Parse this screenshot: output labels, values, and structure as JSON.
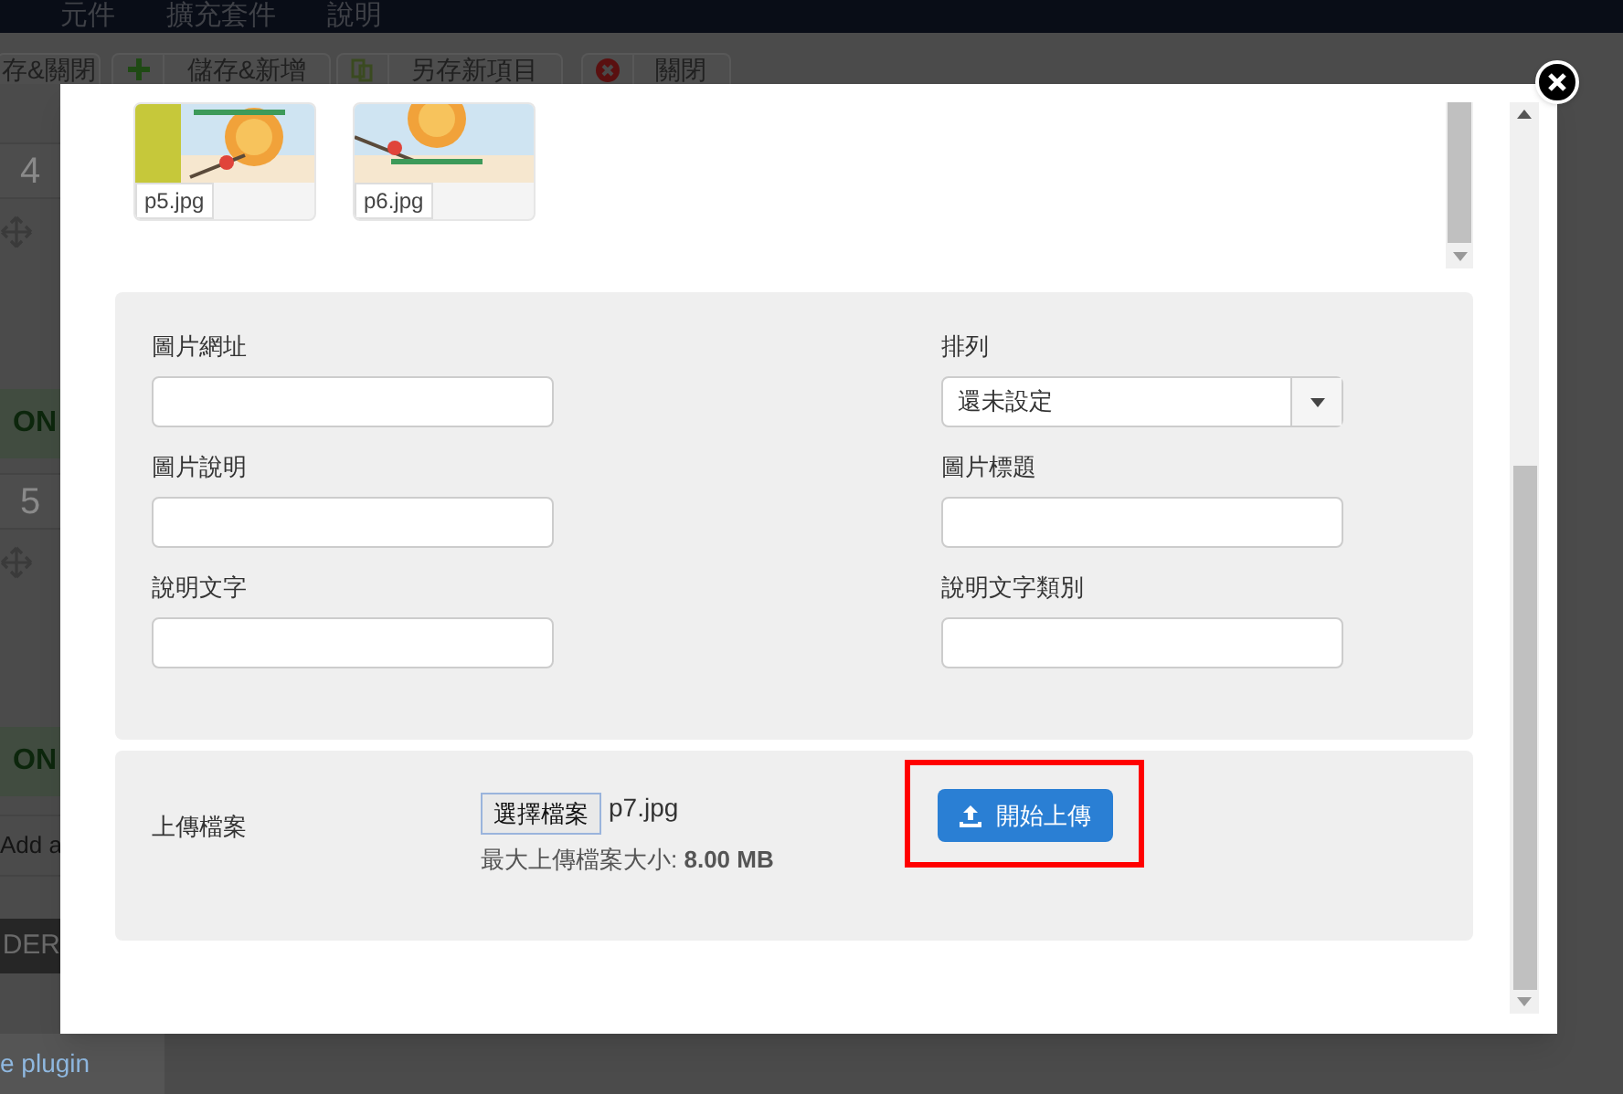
{
  "menu": [
    {
      "label": "元件"
    },
    {
      "label": "擴充套件"
    },
    {
      "label": "說明"
    }
  ],
  "toolbar": [
    {
      "label": "存&關閉"
    },
    {
      "label": "儲存&新增"
    },
    {
      "label": "另存新項目"
    },
    {
      "label": "關閉"
    }
  ],
  "sidebar": [
    {
      "kind": "number",
      "text": "4"
    },
    {
      "kind": "move"
    },
    {
      "kind": "status",
      "text": "ON"
    },
    {
      "kind": "number",
      "text": "5"
    },
    {
      "kind": "move"
    },
    {
      "kind": "status",
      "text": "ON"
    },
    {
      "kind": "link",
      "text": "Add a"
    },
    {
      "kind": "header",
      "text": "DER"
    }
  ],
  "footer_link": "e plugin",
  "modal": {
    "images": [
      {
        "name": "p5.jpg",
        "kind": "picture"
      },
      {
        "name": "p6.jpg",
        "kind": "picture"
      }
    ],
    "fields": [
      {
        "label": "圖片網址",
        "kind": "text"
      },
      {
        "label": "排列",
        "kind": "select",
        "value": "還未設定"
      },
      {
        "label": "圖片說明",
        "kind": "text"
      },
      {
        "label": "圖片標題",
        "kind": "text"
      },
      {
        "label": "說明文字",
        "kind": "text"
      },
      {
        "label": "說明文字類別",
        "kind": "text"
      }
    ],
    "upload": {
      "label": "上傳檔案",
      "choose_button": "選擇檔案",
      "file_name": "p7.jpg",
      "limit_label": "最大上傳檔案大小: ",
      "limit_value": "8.00 MB",
      "submit": "開始上傳",
      "highlighted": true
    }
  }
}
